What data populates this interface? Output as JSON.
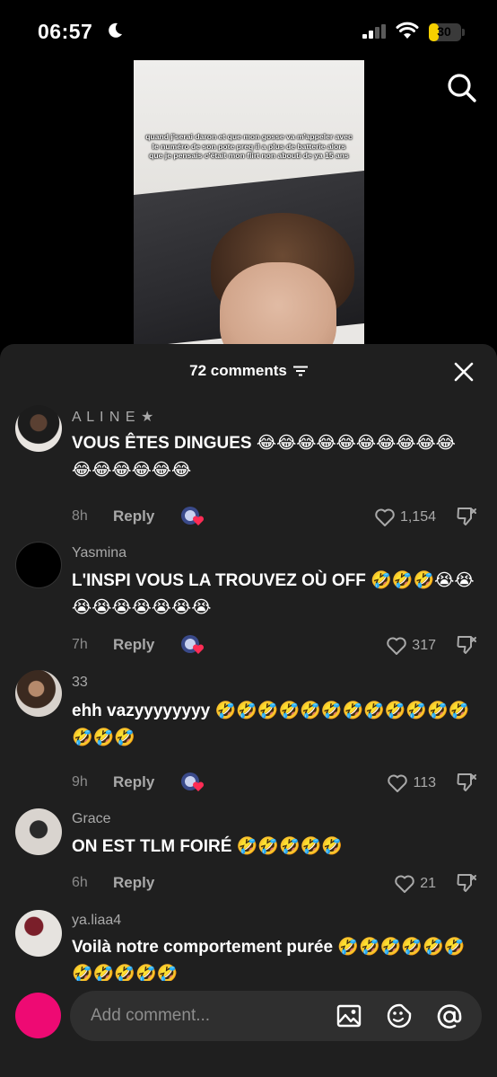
{
  "status_bar": {
    "time": "06:57",
    "battery": "30",
    "battery_level": 0.3
  },
  "video": {
    "caption": "quand j'serai daron et que mon gosse va m'appeler avec le numéro de son pote preq il a plus de batterie alors que je pensais c'était mon flirt non abouti de ya 15 ans"
  },
  "icons": {
    "moon": "moon-icon",
    "signal": "cellular-signal-icon",
    "wifi": "wifi-icon",
    "search": "search-icon",
    "filter": "filter-icon",
    "close": "close-icon",
    "heart": "heart-icon",
    "dislike": "dislike-icon",
    "image": "image-icon",
    "emoji": "emoji-icon",
    "mention": "at-mention-icon"
  },
  "comments_header": {
    "count_label": "72 comments"
  },
  "comments": [
    {
      "username": "A L I N E ★",
      "text": "VOUS ÊTES DINGUES 😂😂😂😂😂😂😂😂😂😂😂😂😂😂😂😂",
      "time": "8h",
      "reply": "Reply",
      "likes": "1,154",
      "creator_liked": true
    },
    {
      "username": "Yasmina",
      "text": "L'INSPI VOUS LA TROUVEZ OÙ OFF 🤣🤣🤣😭😭😭😭😭😭😭😭😭",
      "time": "7h",
      "reply": "Reply",
      "likes": "317",
      "creator_liked": true
    },
    {
      "username": "33",
      "text": "ehh vazyyyyyyyy 🤣🤣🤣🤣🤣🤣🤣🤣🤣🤣🤣🤣🤣🤣🤣",
      "time": "9h",
      "reply": "Reply",
      "likes": "113",
      "creator_liked": true
    },
    {
      "username": "Grace",
      "text": "ON EST TLM FOIRÉ 🤣🤣🤣🤣🤣",
      "time": "6h",
      "reply": "Reply",
      "likes": "21",
      "creator_liked": false
    },
    {
      "username": "ya.liaa4",
      "text": "Voilà notre comportement purée 🤣🤣🤣🤣🤣🤣🤣🤣🤣🤣🤣",
      "time": "",
      "reply": "",
      "likes": "",
      "creator_liked": false
    }
  ],
  "input": {
    "placeholder": "Add comment..."
  },
  "colors": {
    "panel_bg": "#1f1f1f",
    "accent_pink": "#ee0a73",
    "battery_yellow": "#f5d000",
    "muted_text": "#a9a9a9"
  }
}
